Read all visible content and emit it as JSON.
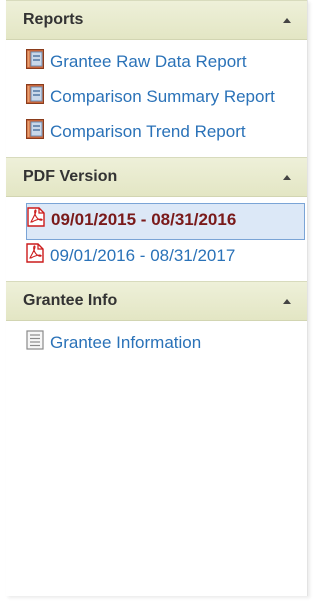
{
  "sections": [
    {
      "title": "Reports",
      "items": [
        {
          "label": "Grantee Raw Data Report",
          "icon": "report-icon"
        },
        {
          "label": "Comparison Summary Report",
          "icon": "report-icon"
        },
        {
          "label": "Comparison Trend Report",
          "icon": "report-icon"
        }
      ]
    },
    {
      "title": "PDF Version",
      "items": [
        {
          "label": "09/01/2015 - 08/31/2016",
          "icon": "pdf-icon",
          "selected": true
        },
        {
          "label": "09/01/2016 - 08/31/2017",
          "icon": "pdf-icon"
        }
      ]
    },
    {
      "title": "Grantee Info",
      "items": [
        {
          "label": "Grantee Information",
          "icon": "document-icon"
        }
      ]
    }
  ],
  "colors": {
    "link": "#2a72b8",
    "selected_text": "#7a1a1a",
    "selected_bg": "#dce8f7",
    "header_bg": "#e3e6c4"
  }
}
